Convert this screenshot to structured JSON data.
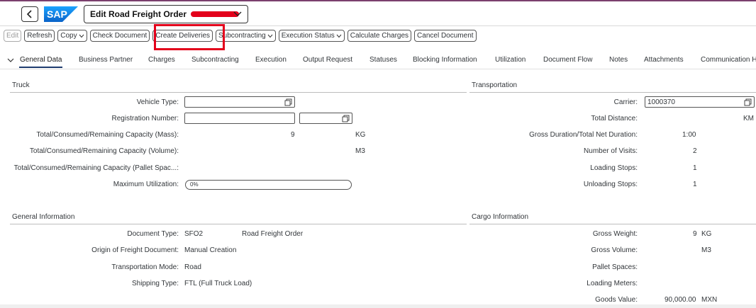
{
  "colors": {
    "brand": "#0a6ed1",
    "highlight": "#e3001b",
    "topline": "#7b3f6e"
  },
  "shell": {
    "logo_text": "SAP",
    "title": "Edit Road Freight Order"
  },
  "toolbar": {
    "buttons": [
      {
        "label": "Edit",
        "disabled": true,
        "menu": false
      },
      {
        "label": "Refresh",
        "disabled": false,
        "menu": false
      },
      {
        "label": "Copy",
        "disabled": false,
        "menu": true
      },
      {
        "label": "Check Document",
        "disabled": false,
        "menu": false
      },
      {
        "label": "Create Deliveries",
        "disabled": false,
        "menu": false
      },
      {
        "label": "Subcontracting",
        "disabled": false,
        "menu": true
      },
      {
        "label": "Execution Status",
        "disabled": false,
        "menu": true
      },
      {
        "label": "Calculate Charges",
        "disabled": false,
        "menu": false
      },
      {
        "label": "Cancel Document",
        "disabled": false,
        "menu": false
      }
    ]
  },
  "tabs": [
    {
      "label": "General Data",
      "active": true
    },
    {
      "label": "Business Partner"
    },
    {
      "label": "Charges"
    },
    {
      "label": "Subcontracting"
    },
    {
      "label": "Execution"
    },
    {
      "label": "Output Request"
    },
    {
      "label": "Statuses"
    },
    {
      "label": "Blocking Information"
    },
    {
      "label": "Utilization"
    },
    {
      "label": "Document Flow"
    },
    {
      "label": "Notes"
    },
    {
      "label": "Attachments"
    },
    {
      "label": "Communication H"
    }
  ],
  "truck": {
    "title": "Truck",
    "vehicle_type_label": "Vehicle Type:",
    "vehicle_type_value": "",
    "registration_label": "Registration Number:",
    "registration_value": "",
    "registration_value2": "",
    "mass_label": "Total/Consumed/Remaining Capacity (Mass):",
    "mass_value": "9",
    "mass_unit": "KG",
    "volume_label": "Total/Consumed/Remaining Capacity (Volume):",
    "volume_unit": "M3",
    "pallet_label": "Total/Consumed/Remaining Capacity (Pallet Spac...:",
    "max_util_label": "Maximum Utilization:",
    "max_util_text": "0%",
    "max_util_fraction": 0
  },
  "transportation": {
    "title": "Transportation",
    "carrier_label": "Carrier:",
    "carrier_value": "1000370",
    "distance_label": "Total Distance:",
    "distance_unit": "KM",
    "duration_label": "Gross Duration/Total Net Duration:",
    "duration_value": "1:00",
    "visits_label": "Number of Visits:",
    "visits_value": "2",
    "loading_label": "Loading Stops:",
    "loading_value": "1",
    "unloading_label": "Unloading Stops:",
    "unloading_value": "1"
  },
  "general_info": {
    "title": "General Information",
    "doc_type_label": "Document Type:",
    "doc_type_code": "SFO2",
    "doc_type_desc": "Road Freight Order",
    "origin_label": "Origin of Freight Document:",
    "origin_value": "Manual Creation",
    "mode_label": "Transportation Mode:",
    "mode_value": "Road",
    "shipping_label": "Shipping Type:",
    "shipping_value": "FTL (Full Truck Load)"
  },
  "cargo": {
    "title": "Cargo Information",
    "gross_weight_label": "Gross Weight:",
    "gross_weight_value": "9",
    "gross_weight_unit": "KG",
    "gross_volume_label": "Gross Volume:",
    "gross_volume_unit": "M3",
    "pallet_label": "Pallet Spaces:",
    "loading_meters_label": "Loading Meters:",
    "goods_value_label": "Goods Value:",
    "goods_value": "90,000.00",
    "goods_currency": "MXN"
  }
}
